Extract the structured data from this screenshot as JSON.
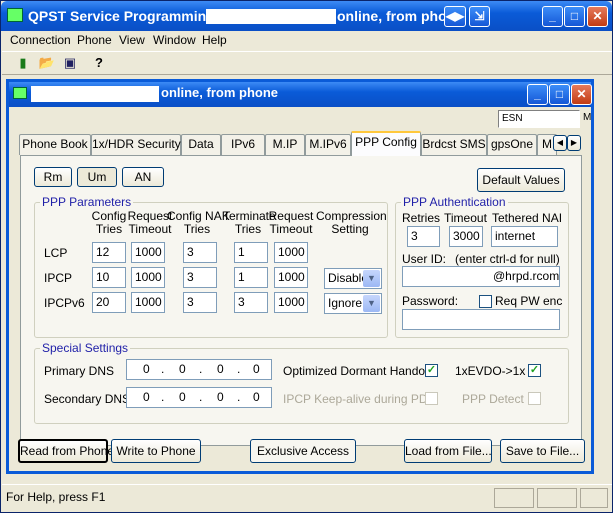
{
  "app": {
    "title_left": "QPST Service Programming -",
    "title_right": "online, from phon",
    "menu": [
      "Connection",
      "Phone",
      "View",
      "Window",
      "Help"
    ],
    "toolbar_icons": [
      "phone-icon",
      "open-folder-icon",
      "save-icon",
      "help-icon"
    ],
    "status": "For Help, press F1"
  },
  "inner": {
    "title": "online, from phone",
    "esn_label": "ESN",
    "esn_suffix": "M",
    "tabs": [
      "Phone Book",
      "1x/HDR Security",
      "Data",
      "IPv6",
      "M.IP",
      "M.IPv6",
      "PPP Config",
      "Brdcst SMS",
      "gpsOne",
      "M"
    ],
    "active_tab": "PPP Config"
  },
  "ppp": {
    "subtabs": [
      "Rm",
      "Um",
      "AN"
    ],
    "active_subtab": "Um",
    "default_values": "Default Values",
    "params_title": "PPP Parameters",
    "col_config_tries": "Config\nTries",
    "col_request_timeout": "Request\nTimeout",
    "col_config_nak": "Config NAK\nTries",
    "col_terminate_tries": "Terminate\nTries",
    "col_terminate_request": "Request\nTimeout",
    "col_compression": "Compression\nSetting",
    "rows": [
      {
        "name": "LCP",
        "config_tries": "12",
        "request_timeout": "1000",
        "config_nak": "3",
        "terminate_tries": "1",
        "terminate_timeout": "1000",
        "compression": ""
      },
      {
        "name": "IPCP",
        "config_tries": "10",
        "request_timeout": "1000",
        "config_nak": "3",
        "terminate_tries": "1",
        "terminate_timeout": "1000",
        "compression": "Disable"
      },
      {
        "name": "IPCPv6",
        "config_tries": "20",
        "request_timeout": "1000",
        "config_nak": "3",
        "terminate_tries": "3",
        "terminate_timeout": "1000",
        "compression": "Ignore"
      }
    ]
  },
  "auth": {
    "title": "PPP Authentication",
    "retries_label": "Retries",
    "timeout_label": "Timeout",
    "nai_label": "Tethered NAI",
    "retries": "3",
    "timeout": "3000",
    "nai": "internet",
    "userid_label": "User ID:",
    "userid_hint": "(enter ctrl-d for null)",
    "userid_value": "@hrpd.rcom.",
    "password_label": "Password:",
    "req_pw_enc": "Req PW enc",
    "password": ""
  },
  "special": {
    "title": "Special Settings",
    "primary_dns_label": "Primary DNS",
    "secondary_dns_label": "Secondary DNS",
    "primary_dns": [
      "0",
      "0",
      "0",
      "0"
    ],
    "secondary_dns": [
      "0",
      "0",
      "0",
      "0"
    ],
    "dormant_handoff": "Optimized Dormant Handoff",
    "evdo": "1xEVDO->1x",
    "ipcp_keepalive": "IPCP Keep-alive during PDP",
    "ppp_detect": "PPP Detect",
    "check_mark": "✓"
  },
  "buttons": {
    "read": "Read from Phone",
    "write": "Write to Phone",
    "exclusive": "Exclusive Access",
    "load": "Load from File...",
    "save": "Save to File..."
  }
}
